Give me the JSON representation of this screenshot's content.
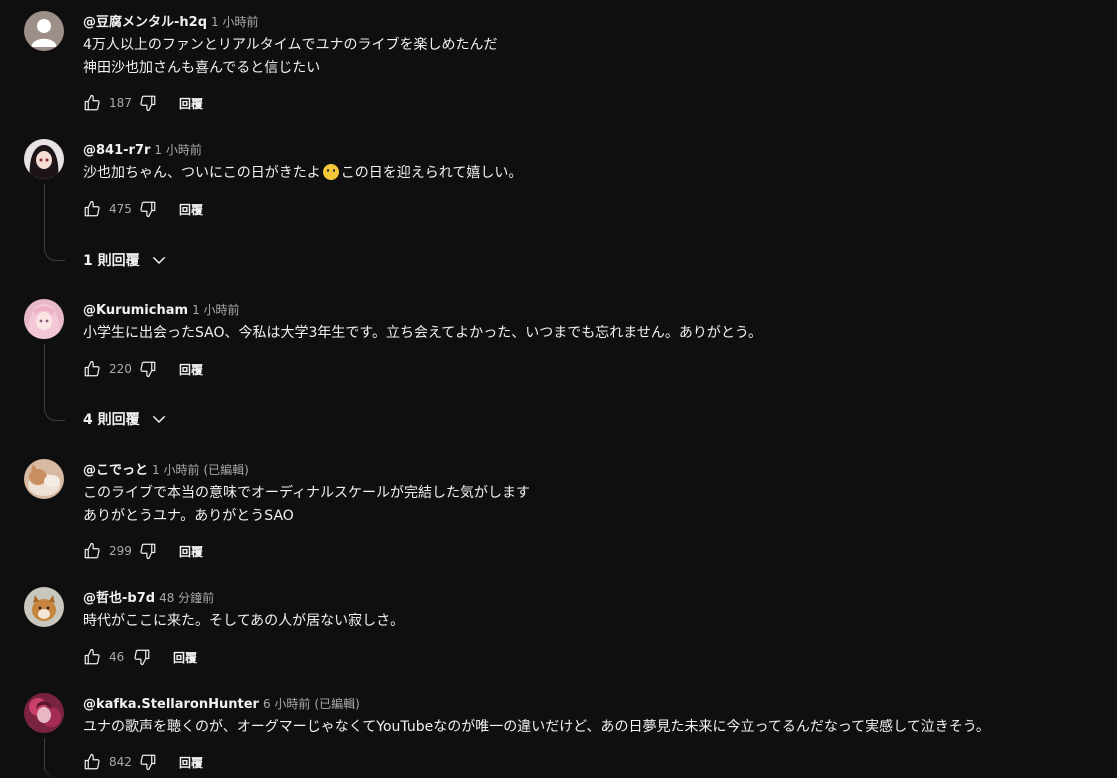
{
  "comments": [
    {
      "author": "@豆腐メンタル-h2q",
      "time": "1 小時前",
      "edited": "",
      "lines": [
        "4万人以上のファンとリアルタイムでユナのライブを楽しめたんだ",
        "神田沙也加さんも喜んでると信じたい"
      ],
      "likes": "187",
      "reply_label": "回覆",
      "avatar": {
        "type": "default-person",
        "bg": "#9e8e88"
      }
    },
    {
      "author": "@841-r7r",
      "time": "1 小時前",
      "edited": "",
      "text_before_emoji": "沙也加ちゃん、ついにこの日がきたよ",
      "emoji": "smiling-face-emoji",
      "text_after_emoji": "この日を迎えられて嬉しい。",
      "likes": "475",
      "reply_label": "回覆",
      "replies_label": "1 則回覆",
      "avatar": {
        "type": "anime-dark-hair",
        "bg": "#e8e2e6"
      }
    },
    {
      "author": "@Kurumicham",
      "time": "1 小時前",
      "edited": "",
      "lines": [
        "小学生に出会ったSAO、今私は大学3年生です。立ち会えてよかった、いつまでも忘れません。ありがとう。"
      ],
      "likes": "220",
      "reply_label": "回覆",
      "replies_label": "4 則回覆",
      "avatar": {
        "type": "anime-pink-hair",
        "bg": "#e7b9c8"
      }
    },
    {
      "author": "@こでっと",
      "time": "1 小時前",
      "edited": "(已編輯)",
      "lines": [
        "このライブで本当の意味でオーディナルスケールが完結した気がします",
        "ありがとうユナ。ありがとうSAO"
      ],
      "likes": "299",
      "reply_label": "回覆",
      "avatar": {
        "type": "photo-cat",
        "bg": "#d8b9a1"
      }
    },
    {
      "author": "@哲也-b7d",
      "time": "48 分鐘前",
      "edited": "",
      "lines": [
        "時代がここに来た。そしてあの人が居ない寂しさ。"
      ],
      "likes": "46",
      "reply_label": "回覆",
      "avatar": {
        "type": "photo-dog",
        "bg": "#c9c6bd"
      }
    },
    {
      "author": "@kafka.StellaronHunter",
      "time": "6 小時前",
      "edited": "(已編輯)",
      "lines": [
        "ユナの歌声を聴くのが、オーグマーじゃなくてYouTubeなのが唯一の違いだけど、あの日夢見た未来に今立ってるんだなって実感して泣きそう。"
      ],
      "likes": "842",
      "reply_label": "回覆",
      "avatar": {
        "type": "anime-magenta",
        "bg": "#7a2340"
      }
    }
  ],
  "icons": {
    "like": "thumbs-up-icon",
    "dislike": "thumbs-down-icon",
    "expand": "chevron-down-icon"
  },
  "colors": {
    "background": "#0f0f0f",
    "text": "#f1f1f1",
    "secondary_text": "#aaaaaa",
    "thread_line": "#3f3f3f"
  }
}
